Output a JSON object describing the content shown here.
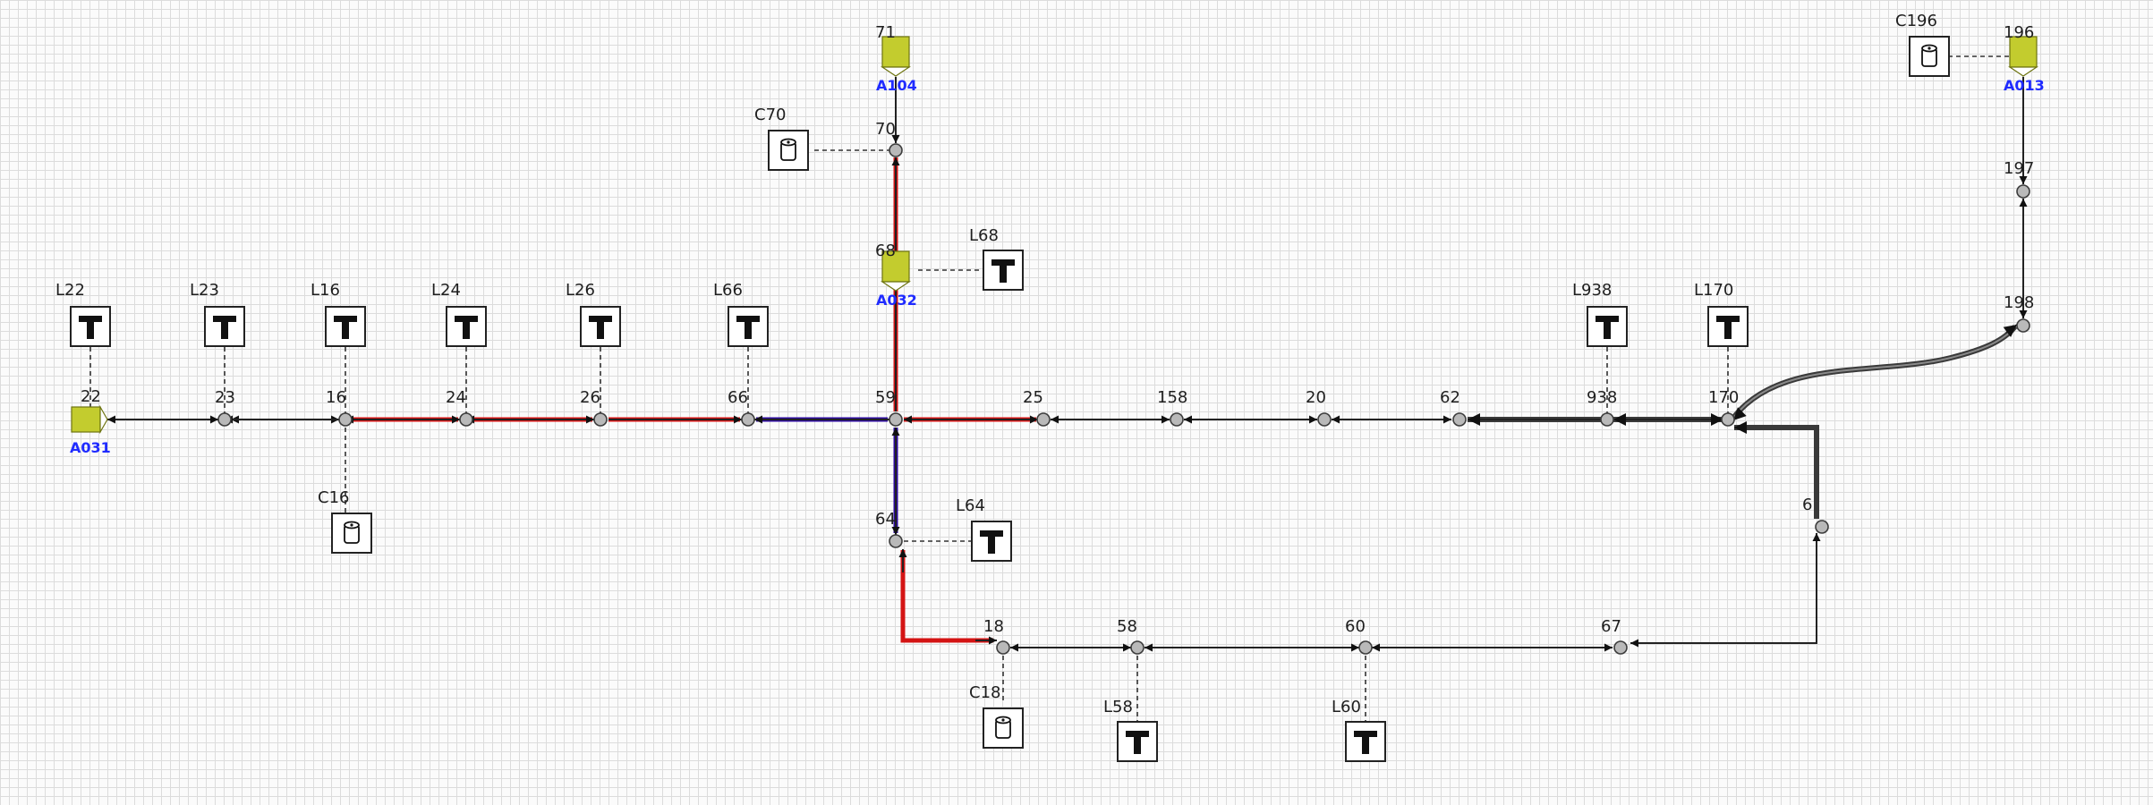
{
  "labels": {
    "n22": "22",
    "n23": "23",
    "n16": "16",
    "n24": "24",
    "n26": "26",
    "n66": "66",
    "n59": "59",
    "n25": "25",
    "n158": "158",
    "n20": "20",
    "n62": "62",
    "n938": "938",
    "n170": "170",
    "n71": "71",
    "n70": "70",
    "n68": "68",
    "n64": "64",
    "n18": "18",
    "n58": "58",
    "n60": "60",
    "n67": "67",
    "n6x": "6",
    "n196": "196",
    "n197": "197",
    "n198": "198"
  },
  "tools": {
    "L22": "L22",
    "L23": "L23",
    "L16": "L16",
    "L24": "L24",
    "L26": "L26",
    "L66": "L66",
    "L68": "L68",
    "L64": "L64",
    "L938": "L938",
    "L170": "L170",
    "L58": "L58",
    "L60": "L60"
  },
  "cans": {
    "C70": "C70",
    "C16": "C16",
    "C18": "C18",
    "C196": "C196"
  },
  "sources": {
    "A031": "A031",
    "A104": "A104",
    "A032": "A032",
    "A013": "A013"
  },
  "colors": {
    "red_path": "#d41414",
    "blue_path": "#2c0a9e",
    "source_fill": "#c3cc2e",
    "source_label": "#1f2bff"
  }
}
